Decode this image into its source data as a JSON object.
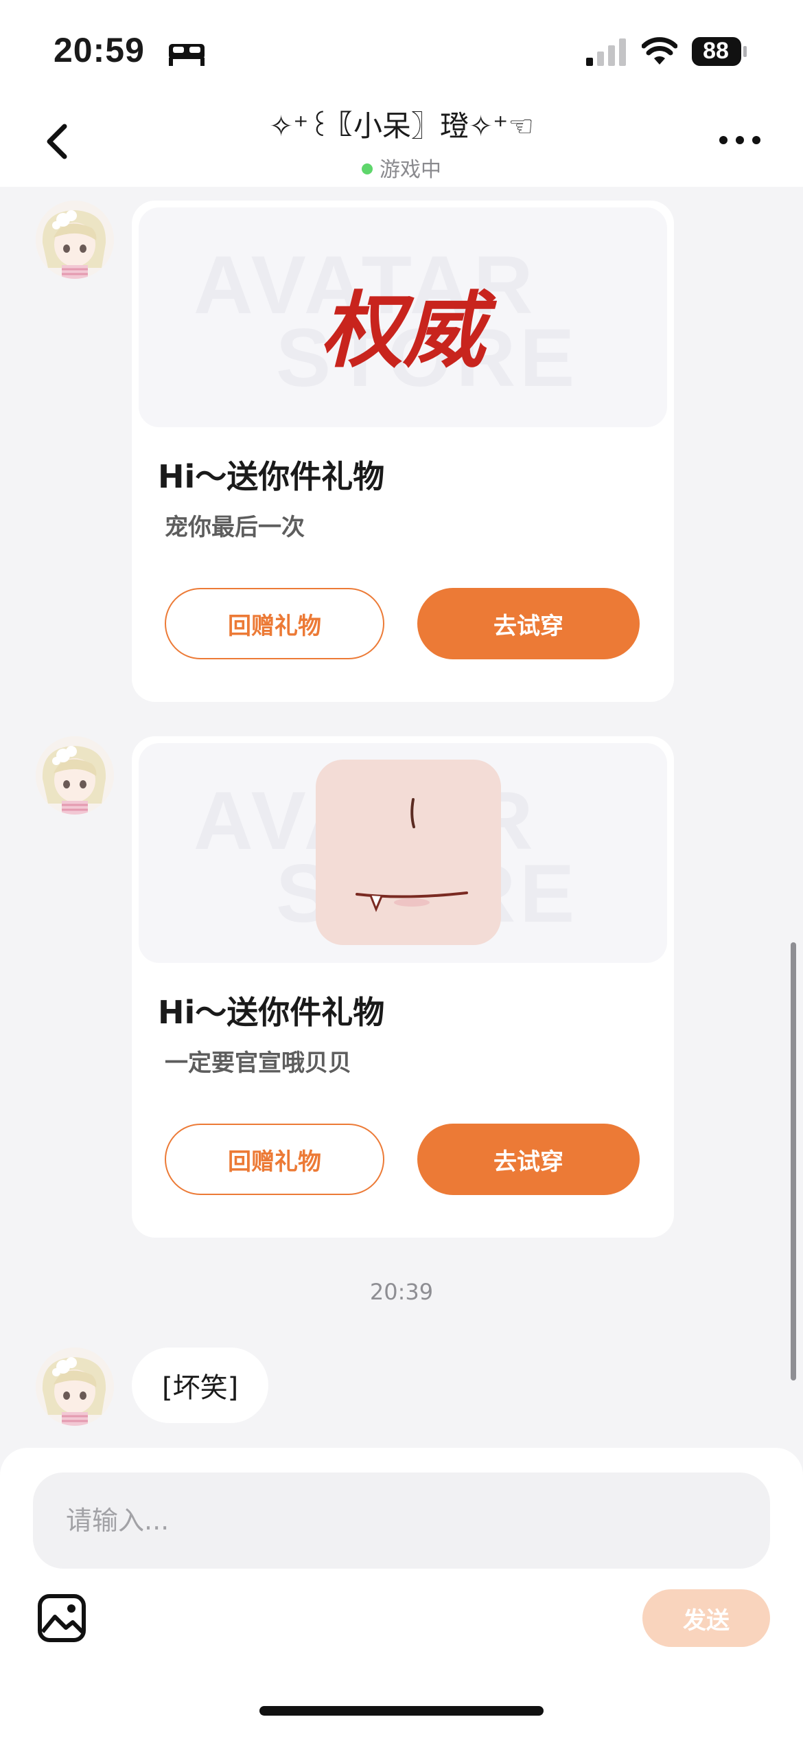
{
  "status_bar": {
    "time": "20:59",
    "battery": "88",
    "icons": [
      "bed-icon",
      "signal-icon",
      "wifi-icon",
      "battery-icon"
    ]
  },
  "header": {
    "title": "✧⁺꒰〖小呆〗璒✧⁺☜",
    "status": "游戏中",
    "icons": [
      "back-arrow-icon",
      "more-options-icon"
    ]
  },
  "messages": {
    "gift1": {
      "badge_text": "权威",
      "watermark_line1": "AVATAR",
      "watermark_line2": "STORE",
      "title": "Hi～送你件礼物",
      "message": "宠你最后一次",
      "return_gift_label": "回赠礼物",
      "try_on_label": "去试穿"
    },
    "gift2": {
      "watermark_line1": "AVATAR",
      "watermark_line2": "STORE",
      "title": "Hi～送你件礼物",
      "message": "一定要官宣哦贝贝",
      "return_gift_label": "回赠礼物",
      "try_on_label": "去试穿"
    },
    "timestamp": "20:39",
    "text_message": "[坏笑]"
  },
  "input_bar": {
    "placeholder": "请输入...",
    "send_label": "发送",
    "icons": [
      "image-icon"
    ]
  },
  "colors": {
    "accent": "#ec7a36",
    "send_disabled": "#f9d4bd",
    "online": "#5ed66b",
    "background": "#f4f4f6",
    "badge_red": "#c8241d"
  }
}
